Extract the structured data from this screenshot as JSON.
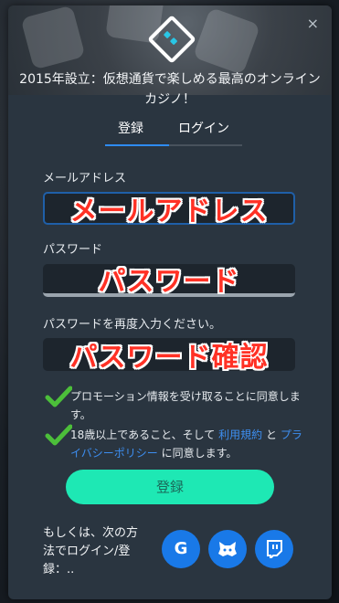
{
  "modal": {
    "close_label": "×",
    "tagline": "2015年設立：仮想通貨で楽しめる最高のオンラインカジノ！"
  },
  "tabs": [
    {
      "label": "登録",
      "active": true
    },
    {
      "label": "ログイン",
      "active": false
    }
  ],
  "form": {
    "email": {
      "label": "メールアドレス",
      "annotation": "メールアドレス"
    },
    "password": {
      "label": "パスワード",
      "annotation": "パスワード"
    },
    "password_confirm": {
      "label": "パスワードを再度入力ください。",
      "annotation": "パスワード確認"
    }
  },
  "checks": {
    "promo_text": "プロモーション情報を受け取ることに同意します。",
    "age_prefix": "18歳以上であること、そして",
    "terms_link": "利用規約",
    "and_text": "と",
    "privacy_link": "プライバシーポリシー",
    "age_suffix": "に同意します。"
  },
  "register_button": "登録",
  "social": {
    "text": "もしくは、次の方法でログイン/登録：..",
    "google_label": "G"
  },
  "colors": {
    "accent": "#1ee8b4",
    "link": "#3d8ef0",
    "social": "#1979e8",
    "annotation": "#ff3125"
  }
}
